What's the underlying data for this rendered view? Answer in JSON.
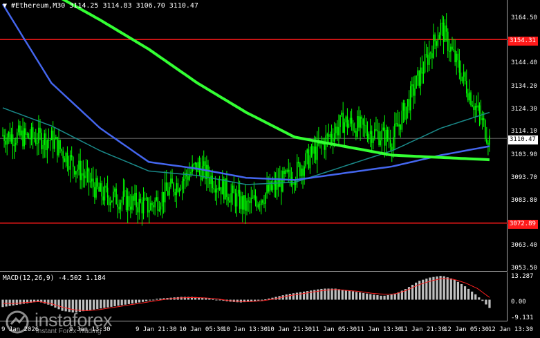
{
  "header": {
    "dropdown_arrow": "▼",
    "title": "#Ethereum,M30  3114.25 3114.83 3106.70 3110.47"
  },
  "macd": {
    "title": "MACD(12,26,9) -4.502 1.184"
  },
  "price_axis": [
    "3164.50",
    "3154.31",
    "3144.40",
    "3134.20",
    "3124.30",
    "3114.10",
    "3110.47",
    "3103.90",
    "3093.70",
    "3083.80",
    "3072.89",
    "3063.40",
    "3053.50"
  ],
  "macd_axis": [
    "13.287",
    "0.00",
    "-9.131"
  ],
  "tags": {
    "resistance": "3154.31",
    "current": "3110.47",
    "support": "3072.89"
  },
  "time_axis": [
    "9 Jan 2026",
    "9 Jan 13:30",
    "9 Jan 21:30",
    "10 Jan 05:30",
    "10 Jan 13:30",
    "10 Jan 21:30",
    "11 Jan 05:30",
    "11 Jan 13:30",
    "11 Jan 21:30",
    "12 Jan 05:30",
    "12 Jan 13:30"
  ],
  "watermark": {
    "brand": "instaforex",
    "sub": "Instant Forex Trading"
  },
  "colors": {
    "candle": "#00ff00",
    "ma_slow": "#33ff33",
    "ma_fast": "#4466ee",
    "ma_mid": "#1a8a8a",
    "level": "#ff1a1a",
    "macd_signal": "#ff2020",
    "macd_hist": "#c0c0c0"
  },
  "chart_data": {
    "type": "line",
    "symbol": "#Ethereum",
    "timeframe": "M30",
    "last_bar": {
      "open": 3114.25,
      "high": 3114.83,
      "low": 3106.7,
      "close": 3110.47
    },
    "levels": {
      "resistance": 3154.31,
      "support": 3072.89
    },
    "ylim": [
      3053.5,
      3170
    ],
    "x": [
      "9 Jan 2026",
      "9 Jan 13:30",
      "9 Jan 21:30",
      "10 Jan 05:30",
      "10 Jan 13:30",
      "10 Jan 21:30",
      "11 Jan 05:30",
      "11 Jan 13:30",
      "11 Jan 21:30",
      "12 Jan 05:30",
      "12 Jan 13:30"
    ],
    "series": [
      {
        "name": "",
        "values": [
          3112,
          3110,
          3086,
          3080,
          3098,
          3080,
          3095,
          3118,
          3110,
          3160,
          3110
        ]
      },
      {
        "name": "",
        "values": [
          3170,
          3135,
          3115,
          3100,
          3097,
          3093,
          3092,
          3095,
          3098,
          3103,
          3107
        ]
      },
      {
        "name": "",
        "values": [
          3124,
          3116,
          3105,
          3096,
          3094,
          3090,
          3091,
          3098,
          3105,
          3115,
          3122
        ]
      },
      {
        "name": "",
        "values": [
          3185,
          3175,
          3163,
          3150,
          3135,
          3122,
          3111,
          3107,
          3103,
          3102,
          3101
        ]
      }
    ],
    "macd": {
      "params": "12,26,9",
      "main": -4.502,
      "signal": 1.184,
      "ylim": [
        -9.131,
        13.287
      ]
    }
  }
}
